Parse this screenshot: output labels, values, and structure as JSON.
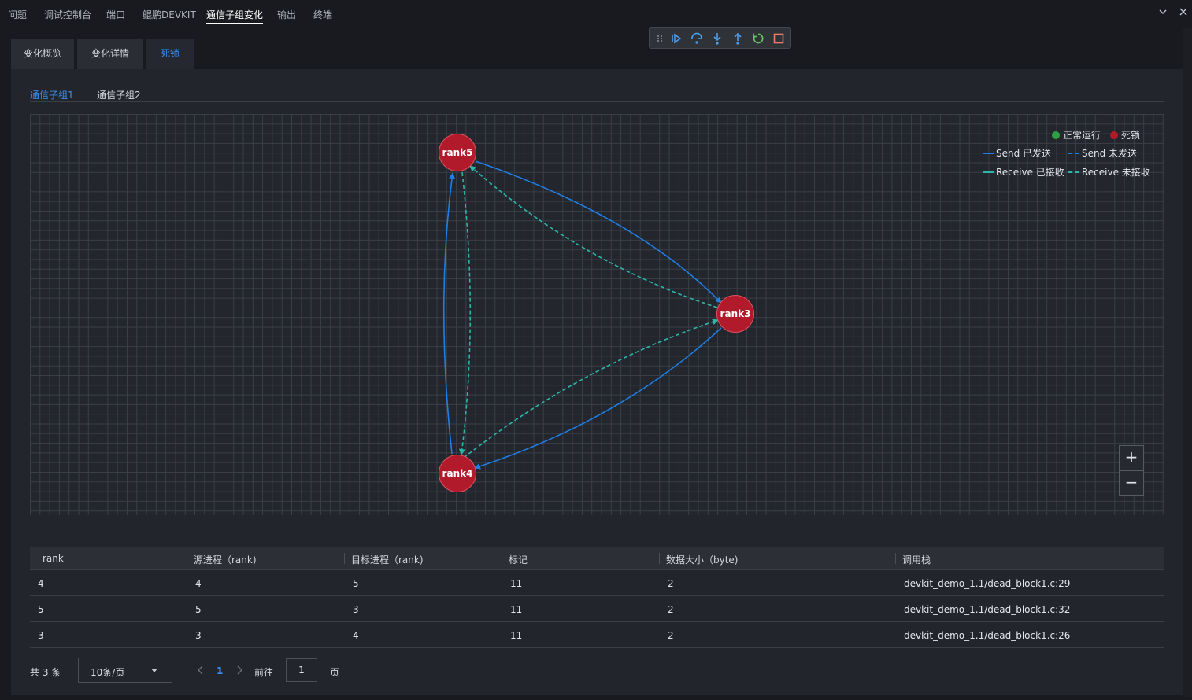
{
  "panel_tabs": [
    "问题",
    "调试控制台",
    "端口",
    "鲲鹏DEVKIT",
    "通信子组变化",
    "输出",
    "终端"
  ],
  "panel_active_tab": "通信子组变化",
  "panel_icons": {
    "collapse": "chevron-down-icon",
    "close": "close-icon"
  },
  "debug_toolbar": [
    "drag-handle-icon",
    "continue-icon",
    "step-over-icon",
    "step-into-icon",
    "step-out-icon",
    "restart-icon",
    "stop-icon"
  ],
  "content_tabs": [
    "变化概览",
    "变化详情",
    "死锁"
  ],
  "content_active_tab": "死锁",
  "sub_tabs": [
    "通信子组1",
    "通信子组2"
  ],
  "sub_active_tab": "通信子组1",
  "legend": {
    "normal": "正常运行",
    "deadlock": "死锁",
    "send_done": "Send 已发送",
    "send_pending": "Send 未发送",
    "recv_done": "Receive 已接收",
    "recv_pending": "Receive 未接收"
  },
  "colors": {
    "normal": "#2ea043",
    "deadlock": "#b11a2a",
    "send": "#1e7fe6",
    "receive": "#2cb5a8",
    "accent": "#3b8ef0"
  },
  "graph": {
    "nodes": [
      {
        "id": "rank5",
        "label": "rank5",
        "status": "deadlock"
      },
      {
        "id": "rank3",
        "label": "rank3",
        "status": "deadlock"
      },
      {
        "id": "rank4",
        "label": "rank4",
        "status": "deadlock"
      }
    ],
    "edges": [
      {
        "from": "rank5",
        "to": "rank3",
        "type": "send",
        "done": true
      },
      {
        "from": "rank3",
        "to": "rank5",
        "type": "receive",
        "done": false
      },
      {
        "from": "rank3",
        "to": "rank4",
        "type": "send",
        "done": true
      },
      {
        "from": "rank4",
        "to": "rank3",
        "type": "receive",
        "done": false
      },
      {
        "from": "rank4",
        "to": "rank5",
        "type": "send",
        "done": true
      },
      {
        "from": "rank5",
        "to": "rank4",
        "type": "receive",
        "done": false
      }
    ]
  },
  "zoom": {
    "in": "+",
    "out": "−"
  },
  "table": {
    "headers": [
      "rank",
      "源进程（rank)",
      "目标进程（rank)",
      "标记",
      "数据大小（byte)",
      "调用栈"
    ],
    "rows": [
      [
        "4",
        "4",
        "5",
        "11",
        "2",
        "devkit_demo_1.1/dead_block1.c:29"
      ],
      [
        "5",
        "5",
        "3",
        "11",
        "2",
        "devkit_demo_1.1/dead_block1.c:32"
      ],
      [
        "3",
        "3",
        "4",
        "11",
        "2",
        "devkit_demo_1.1/dead_block1.c:26"
      ]
    ]
  },
  "pagination": {
    "total": "共 3 条",
    "page_size": "10条/页",
    "current_page": "1",
    "goto_label": "前往",
    "goto_value": "1",
    "page_suffix": "页"
  }
}
